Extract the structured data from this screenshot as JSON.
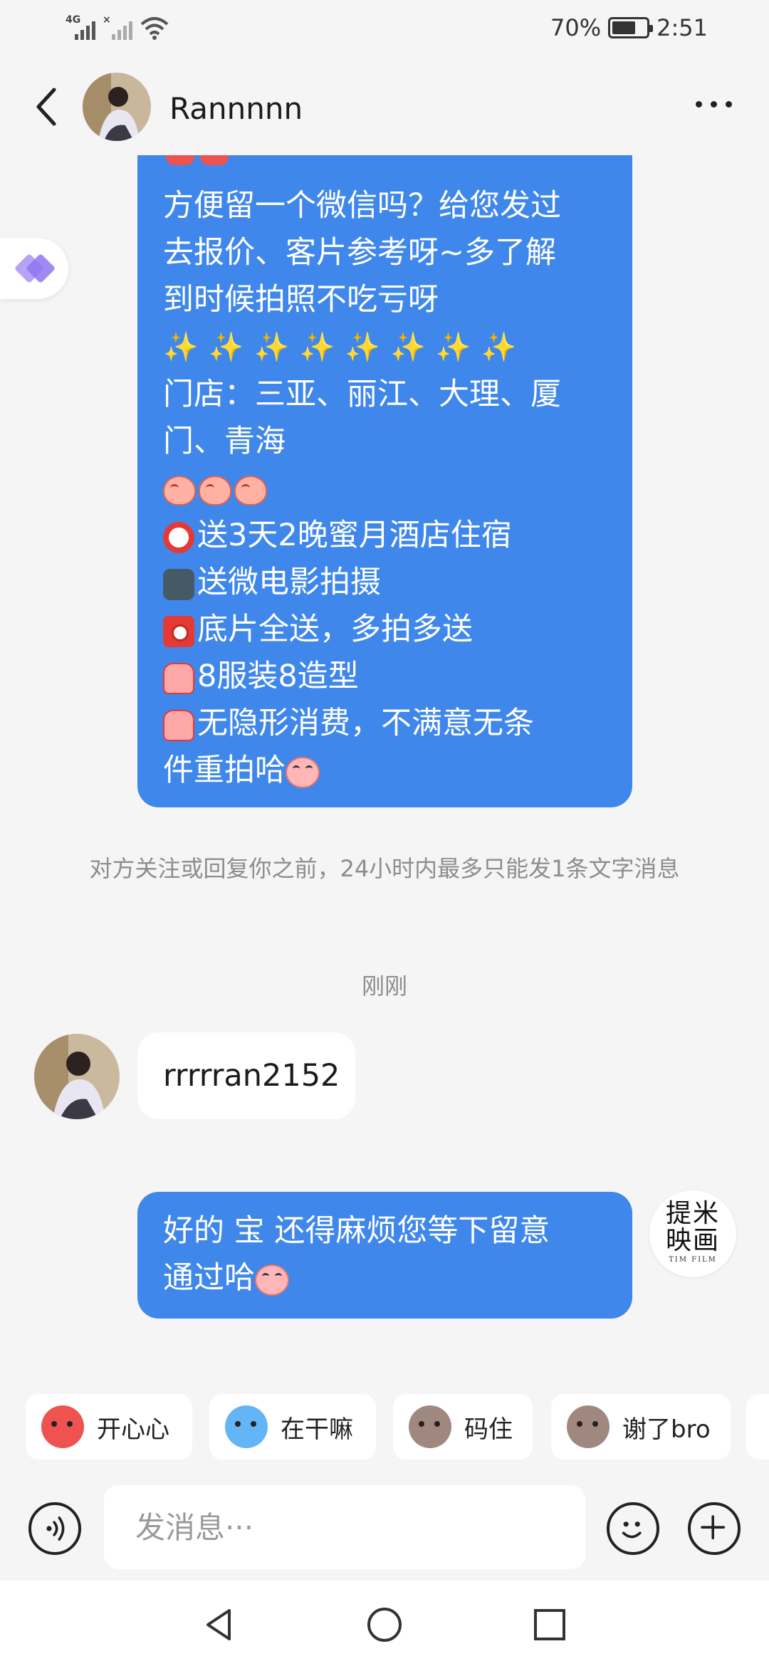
{
  "status": {
    "network_1": "4G",
    "network_2": "×",
    "battery_text": "70%",
    "battery_level": 0.7,
    "time": "2:51"
  },
  "header": {
    "contact_name": "Rannnnn",
    "back_icon": "chevron-left-icon",
    "more_icon": "more-dots-icon"
  },
  "messages": {
    "outgoing_1": {
      "lines": [
        "方便留一个微信吗？给您发过",
        "去报价、客片参考呀~多了解",
        "到时候拍照不吃亏呀",
        "✨✨✨✨✨✨✨✨",
        "门店：三亚、丽江、大理、厦",
        "门、青海",
        "",
        "送3天2晚蜜月酒店住宿",
        "送微电影拍摄",
        "底片全送，多拍多送",
        "8服装8造型",
        "无隐形消费，不满意无条",
        "件重拍哈"
      ]
    },
    "notice": "对方关注或回复你之前，24小时内最多只能发1条文字消息",
    "timestamp": "刚刚",
    "incoming_1": "rrrrran2152",
    "outgoing_2": {
      "line1": "好的 宝 还得麻烦您等下留意",
      "line2": "通过哈"
    },
    "my_avatar": {
      "line1": "提米",
      "line2": "映画",
      "line3": "TIM FILM"
    }
  },
  "quick_replies": [
    {
      "label": "开心心",
      "icon": "happy-sticker-icon",
      "color": "#ef5350"
    },
    {
      "label": "在干嘛",
      "icon": "magnifier-sticker-icon",
      "color": "#64b5f6"
    },
    {
      "label": "码住",
      "icon": "monkey-sticker-icon",
      "color": "#a1887f"
    },
    {
      "label": "谢了bro",
      "icon": "monkey-thanks-sticker-icon",
      "color": "#a1887f"
    }
  ],
  "input": {
    "placeholder": "发消息···",
    "voice_icon": "voice-icon",
    "emoji_icon": "smile-icon",
    "add_icon": "plus-icon"
  },
  "colors": {
    "bubble_out": "#3f87ea",
    "bubble_in": "#ffffff",
    "background": "#f5f5f5"
  }
}
